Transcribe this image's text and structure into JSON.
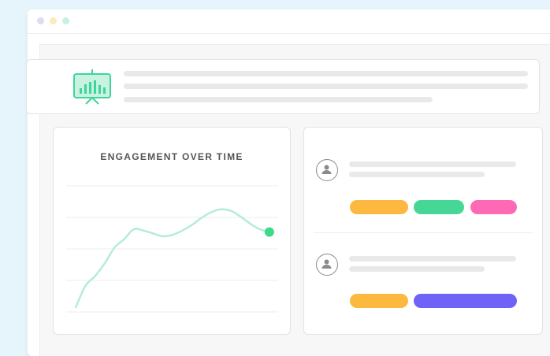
{
  "window": {
    "controls": [
      {
        "name": "close",
        "color": "#e3d9f5"
      },
      {
        "name": "minimize",
        "color": "#fde9bd"
      },
      {
        "name": "maximize",
        "color": "#c9f1e2"
      }
    ]
  },
  "header": {
    "icon": "presentation-chart-icon",
    "icon_color": "#3fd49a"
  },
  "chart": {
    "title": "ENGAGEMENT OVER TIME",
    "line_color": "#b5ecd9",
    "marker_color": "#3fd98a"
  },
  "chart_data": {
    "type": "line",
    "title": "ENGAGEMENT OVER TIME",
    "xlabel": "",
    "ylabel": "",
    "grid": true,
    "x": [
      0,
      1,
      2,
      3,
      4,
      5,
      6,
      7,
      8,
      9,
      10,
      11,
      12,
      13,
      14,
      15,
      16,
      17,
      18,
      19,
      20
    ],
    "values": [
      0.0,
      1.5,
      2.2,
      3.1,
      4.2,
      4.8,
      5.5,
      5.4,
      5.2,
      5.0,
      5.1,
      5.4,
      5.8,
      6.3,
      6.7,
      6.9,
      6.8,
      6.4,
      5.9,
      5.5,
      5.3
    ],
    "ylim": [
      -0.5,
      9.5
    ],
    "xlim": [
      -0.5,
      20.5
    ]
  },
  "users": [
    {
      "avatar_icon": "user-icon",
      "tags": [
        {
          "color": "#fdb83f"
        },
        {
          "color": "#46d696"
        },
        {
          "color": "#fd69b5"
        }
      ]
    },
    {
      "avatar_icon": "user-icon",
      "tags": [
        {
          "color": "#fdb83f"
        },
        {
          "color": "#6e63f6"
        }
      ]
    }
  ]
}
